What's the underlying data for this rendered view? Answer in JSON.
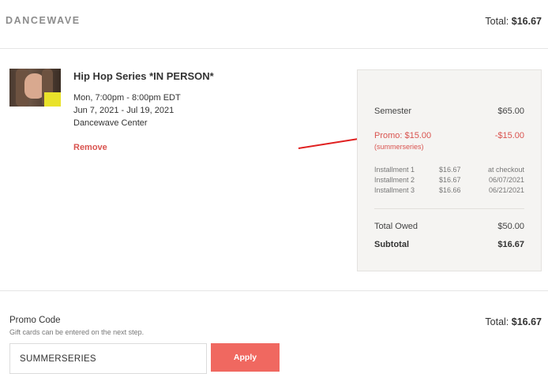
{
  "header": {
    "brand": "DANCEWAVE",
    "total_label": "Total:",
    "total_value": "$16.67"
  },
  "item": {
    "image_icon": "class-thumbnail-photo",
    "title": "Hip Hop Series *IN PERSON*",
    "schedule": "Mon, 7:00pm - 8:00pm EDT",
    "dates": "Jun 7, 2021 - Jul 19, 2021",
    "location": "Dancewave Center",
    "remove_label": "Remove"
  },
  "summary": {
    "semester_label": "Semester",
    "semester_value": "$65.00",
    "promo_label": "Promo: $15.00",
    "promo_value": "-$15.00",
    "promo_code_note": "(summerseries)",
    "installments": [
      {
        "name": "Installment 1",
        "amount": "$16.67",
        "due": "at checkout"
      },
      {
        "name": "Installment 2",
        "amount": "$16.67",
        "due": "06/07/2021"
      },
      {
        "name": "Installment 3",
        "amount": "$16.66",
        "due": "06/21/2021"
      }
    ],
    "total_owed_label": "Total Owed",
    "total_owed_value": "$50.00",
    "subtotal_label": "Subtotal",
    "subtotal_value": "$16.67"
  },
  "promo": {
    "label": "Promo Code",
    "help": "Gift cards can be entered on the next step.",
    "input_value": "SUMMERSERIES",
    "apply_label": "Apply"
  },
  "footer": {
    "total_label": "Total:",
    "total_value": "$16.67"
  },
  "colors": {
    "accent_red": "#d9534f",
    "apply_button": "#f06860",
    "annotation_arrow": "#e02020"
  }
}
